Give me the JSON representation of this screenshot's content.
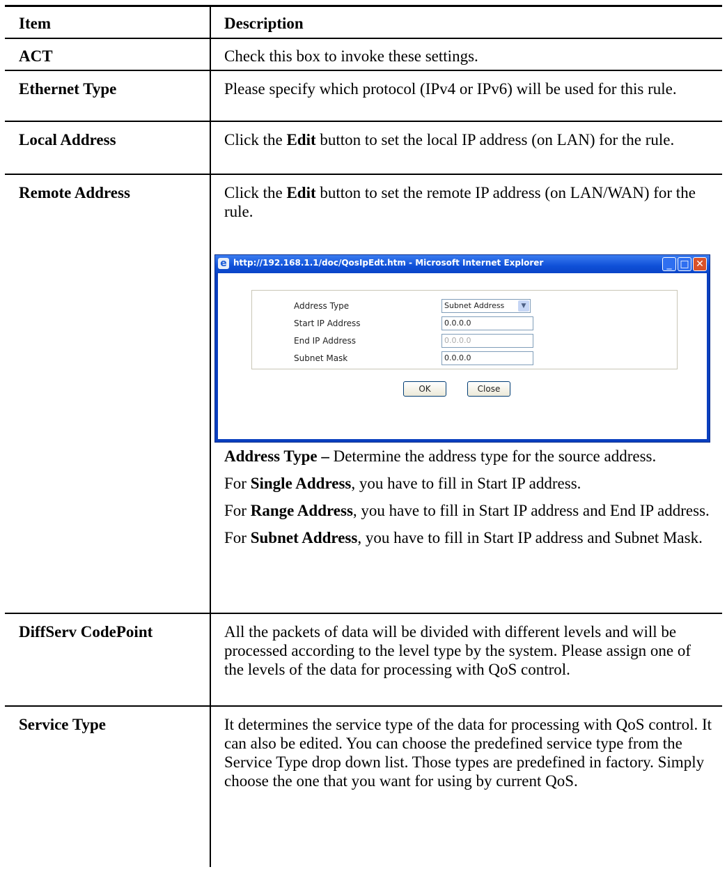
{
  "header": {
    "item": "Item",
    "description": "Description"
  },
  "rows": [
    {
      "item": "ACT",
      "description": "Check this box to invoke these settings."
    },
    {
      "item": "Ethernet Type",
      "description": "Please specify which protocol (IPv4 or IPv6) will be used for this rule."
    },
    {
      "item": "Local Address",
      "description_pre": "Click the ",
      "description_bold": "Edit",
      "description_post": " button to set the local IP address (on LAN) for the rule."
    },
    {
      "item": "Remote Address",
      "description_pre": "Click the ",
      "description_bold": "Edit",
      "description_post": " button to set the remote IP address (on LAN/WAN) for the rule."
    },
    {
      "item": "DiffServ CodePoint",
      "description": "All the packets of data will be divided with different levels and will be processed according to the level type by the system. Please assign one of the levels of the data for processing with QoS control."
    },
    {
      "item": "Service Type",
      "description": "It determines the service type of the data for processing with QoS control. It can also be edited. You can choose the predefined service type from the Service Type drop down list. Those types are predefined in factory. Simply choose the one that you want for using by current QoS."
    }
  ],
  "remote_notes": [
    {
      "bold": "Address Type –",
      "text": " Determine the address type for the source address."
    },
    {
      "pre": "For ",
      "bold": "Single Address",
      "text": ", you have to fill in Start IP address."
    },
    {
      "pre": "For ",
      "bold": "Range Address",
      "text": ", you have to fill in Start IP address and End IP address."
    },
    {
      "pre": "For ",
      "bold": "Subnet Address",
      "text": ", you have to fill in Start IP address and Subnet Mask."
    }
  ],
  "dialog": {
    "title": "http://192.168.1.1/doc/QosIpEdt.htm - Microsoft Internet Explorer",
    "fields": {
      "address_type_label": "Address Type",
      "address_type_value": "Subnet Address",
      "start_ip_label": "Start IP Address",
      "start_ip_value": "0.0.0.0",
      "end_ip_label": "End IP Address",
      "end_ip_value": "0.0.0.0",
      "subnet_mask_label": "Subnet Mask",
      "subnet_mask_value": "0.0.0.0"
    },
    "ok_label": "OK",
    "close_label": "Close",
    "icons": [
      "ie-icon",
      "minimize-icon",
      "maximize-icon",
      "close-icon",
      "chevron-down-icon"
    ],
    "colors": {
      "titlebar": "#0f50d8",
      "close_button": "#d9522a"
    }
  }
}
